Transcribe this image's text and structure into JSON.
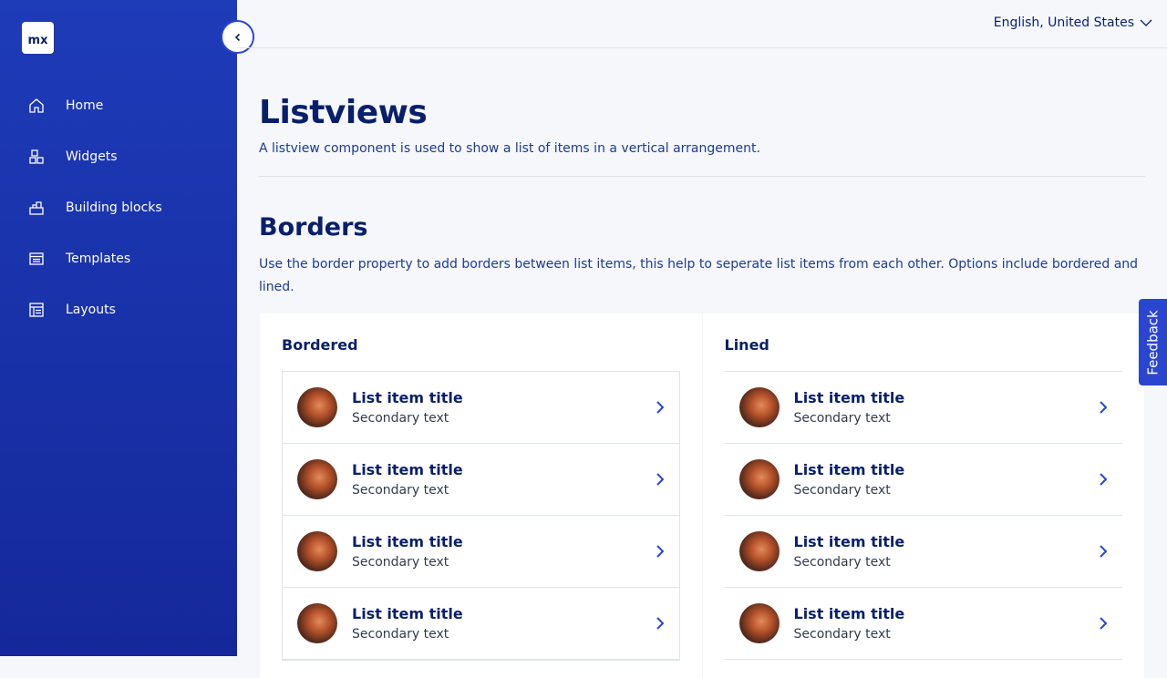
{
  "sidebar": {
    "logo": "mx",
    "items": [
      {
        "label": "Home",
        "icon": "home-icon"
      },
      {
        "label": "Widgets",
        "icon": "widgets-icon"
      },
      {
        "label": "Building blocks",
        "icon": "building-blocks-icon"
      },
      {
        "label": "Templates",
        "icon": "templates-icon"
      },
      {
        "label": "Layouts",
        "icon": "layouts-icon"
      }
    ]
  },
  "topbar": {
    "language": "English, United States"
  },
  "page": {
    "title": "Listviews",
    "description": "A listview component is used to show a list of items in a vertical arrangement."
  },
  "section": {
    "title": "Borders",
    "description": "Use the border property to add borders between list items, this help to seperate list items from each other. Options include bordered and lined."
  },
  "cards": {
    "bordered": {
      "title": "Bordered",
      "items": [
        {
          "title": "List item title",
          "secondary": "Secondary text"
        },
        {
          "title": "List item title",
          "secondary": "Secondary text"
        },
        {
          "title": "List item title",
          "secondary": "Secondary text"
        },
        {
          "title": "List item title",
          "secondary": "Secondary text"
        }
      ]
    },
    "lined": {
      "title": "Lined",
      "items": [
        {
          "title": "List item title",
          "secondary": "Secondary text"
        },
        {
          "title": "List item title",
          "secondary": "Secondary text"
        },
        {
          "title": "List item title",
          "secondary": "Secondary text"
        },
        {
          "title": "List item title",
          "secondary": "Secondary text"
        }
      ]
    }
  },
  "feedback": {
    "label": "Feedback"
  },
  "colors": {
    "sidebar": "#1e3bb8",
    "accent": "#2a46d1",
    "heading": "#0a1f6b"
  }
}
